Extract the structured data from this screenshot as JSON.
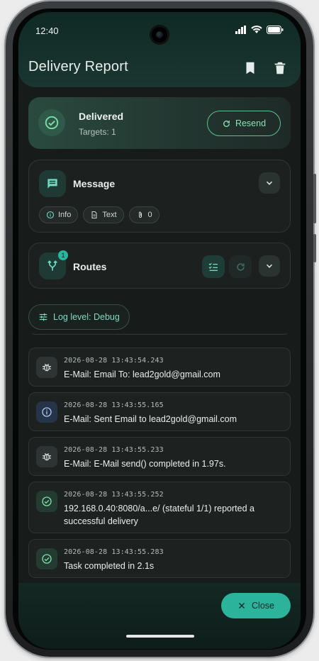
{
  "status_bar": {
    "time": "12:40"
  },
  "header": {
    "title": "Delivery Report",
    "bookmark_icon": "bookmark-icon",
    "delete_icon": "trash-icon"
  },
  "delivery": {
    "status": "Delivered",
    "targets": "Targets: 1",
    "resend_label": "Resend"
  },
  "message_section": {
    "title": "Message",
    "chips": [
      {
        "icon": "info-icon",
        "label": "Info"
      },
      {
        "icon": "document-icon",
        "label": "Text"
      },
      {
        "icon": "attachment-icon",
        "label": "0"
      }
    ]
  },
  "routes_section": {
    "title": "Routes",
    "badge": "1"
  },
  "log_level": {
    "label": "Log level: Debug"
  },
  "logs": [
    {
      "type": "debug",
      "time": "2026-08-28 13:43:54.243",
      "message": "E-Mail: Email To: lead2gold@gmail.com"
    },
    {
      "type": "info",
      "time": "2026-08-28 13:43:55.165",
      "message": "E-Mail: Sent Email to lead2gold@gmail.com"
    },
    {
      "type": "debug",
      "time": "2026-08-28 13:43:55.233",
      "message": "E-Mail: E-Mail send() completed in 1.97s."
    },
    {
      "type": "success",
      "time": "2026-08-28 13:43:55.252",
      "message": "192.168.0.40:8080/a...e/ (stateful 1/1) reported a successful delivery"
    },
    {
      "type": "success",
      "time": "2026-08-28 13:43:55.283",
      "message": "Task completed in 2.1s"
    }
  ],
  "footer": {
    "close_label": "Close"
  },
  "colors": {
    "accent": "#2bb39c",
    "success": "#5fd39a",
    "background": "#171b1a"
  }
}
